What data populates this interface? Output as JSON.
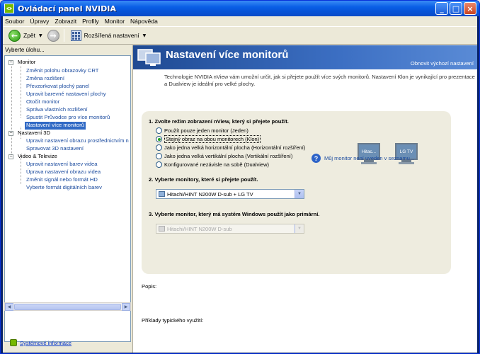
{
  "window": {
    "title": "Ovládací panel NVIDIA",
    "buttons": {
      "minimize": "_",
      "maximize": "□",
      "close": "×"
    }
  },
  "menu": [
    "Soubor",
    "Úpravy",
    "Zobrazit",
    "Profily",
    "Monitor",
    "Nápověda"
  ],
  "toolbar": {
    "back_label": "Zpět",
    "advanced_label": "Rozšířená nastavení"
  },
  "left": {
    "header": "Vyberte úlohu...",
    "tree": [
      {
        "label": "Monitor",
        "type": "cat"
      },
      {
        "label": "Změnit polohu obrazovky CRT",
        "type": "leaf"
      },
      {
        "label": "Změna rozlišení",
        "type": "leaf"
      },
      {
        "label": "Převzorkovat plochý panel",
        "type": "leaf"
      },
      {
        "label": "Upravit barevné nastavení plochy",
        "type": "leaf"
      },
      {
        "label": "Otočit monitor",
        "type": "leaf"
      },
      {
        "label": "Správa vlastních rozlišení",
        "type": "leaf"
      },
      {
        "label": "Spustit Průvodce pro více monitorů",
        "type": "leaf"
      },
      {
        "label": "Nastavení více monitorů",
        "type": "leaf",
        "selected": true
      },
      {
        "label": "Nastavení 3D",
        "type": "cat"
      },
      {
        "label": "Upravit nastavení obrazu prostřednictvím n",
        "type": "leaf"
      },
      {
        "label": "Spravovat 3D nastavení",
        "type": "leaf"
      },
      {
        "label": "Video & Televize",
        "type": "cat"
      },
      {
        "label": "Upravit nastavení barev videa",
        "type": "leaf"
      },
      {
        "label": "Úprava nastavení obrazu videa",
        "type": "leaf"
      },
      {
        "label": "Změnit signál nebo formát HD",
        "type": "leaf"
      },
      {
        "label": "Vyberte formát digitálních barev",
        "type": "leaf"
      }
    ],
    "system_info": "Systémové informace"
  },
  "main": {
    "title": "Nastavení více monitorů",
    "restore_defaults": "Obnovit výchozí nastavení",
    "intro": "Technologie NVIDIA nView vám umožní určit, jak si přejete použít více svých monitorů. Nastavení Klon je vynikající pro prezentace a Dualview je ideální pro velké plochy.",
    "step1": {
      "title": "1. Zvolte režim zobrazení nView, který si přejete použít.",
      "options": [
        {
          "label": "Použít pouze jeden monitor (Jeden)",
          "checked": false
        },
        {
          "label": "Stejný obraz na obou monitorech (Klon)",
          "checked": true
        },
        {
          "label": "Jako jedna velká horizontální plocha (Horizontální rozšíření)",
          "checked": false
        },
        {
          "label": "Jako jedna velká vertikální plocha (Vertikální rozšíření)",
          "checked": false
        },
        {
          "label": "Konfigurované nezávisle na sobě (Dualview)",
          "checked": false
        }
      ],
      "monitor_a": "Hitac...",
      "monitor_b": "LG TV"
    },
    "step2": {
      "title": "2. Vyberte monitory, které si přejete použít.",
      "selected": "Hitachi/HINT N200W D-sub + LG TV",
      "help_link": "Můj monitor není uveden v seznamu..."
    },
    "step3": {
      "title": "3. Vyberte monitor, který má systém Windows použít jako primární.",
      "selected": "Hitachi/HINT N200W D-sub"
    },
    "description_label": "Popis:",
    "examples_label": "Příklady typického využití:"
  },
  "colors": {
    "accent_nvidia": "#76b900",
    "selection": "#316ac5",
    "banner": "#2f5fb0"
  }
}
